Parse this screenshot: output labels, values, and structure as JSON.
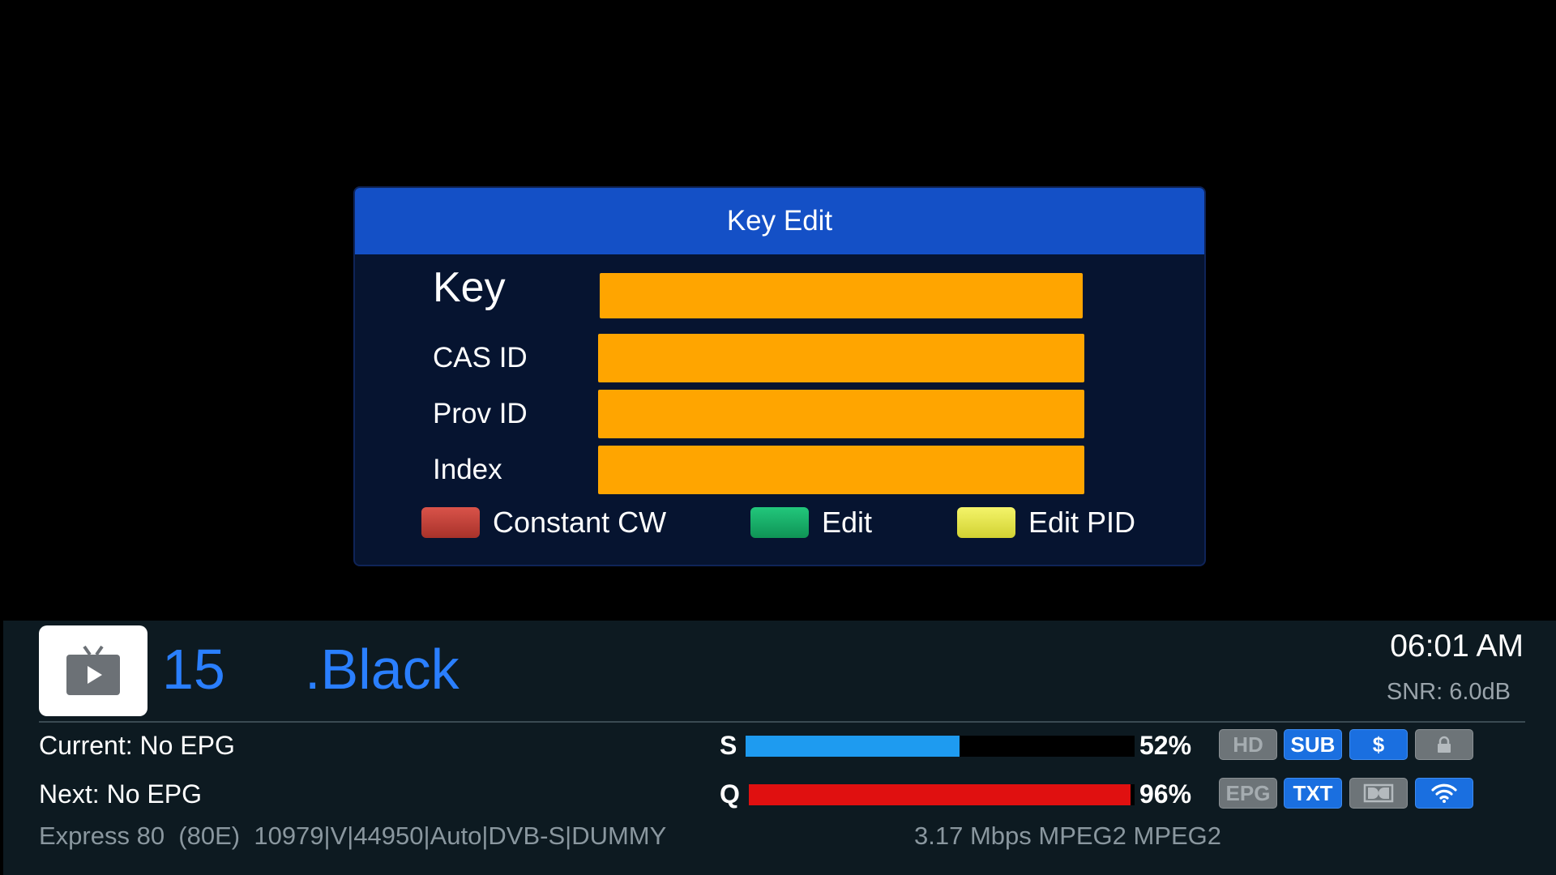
{
  "dialog": {
    "title": "Key Edit",
    "fields": [
      {
        "label": "Key",
        "value": ""
      },
      {
        "label": "CAS ID",
        "value": ""
      },
      {
        "label": "Prov ID",
        "value": ""
      },
      {
        "label": "Index",
        "value": ""
      }
    ],
    "legend": [
      {
        "label": "Constant CW",
        "color": "#c0392b"
      },
      {
        "label": "Edit",
        "color": "#16a765"
      },
      {
        "label": "Edit PID",
        "color": "#e8e84a"
      }
    ],
    "field_color": "#ffa500",
    "header_color": "#1450c6"
  },
  "infobar": {
    "channel_number": "15",
    "channel_name": ".Black",
    "time": "06:01 AM",
    "snr": "SNR: 6.0dB",
    "current_epg": "Current: No EPG",
    "next_epg": "Next: No EPG",
    "satellite": "Express 80  (80E)  10979|V|44950|Auto|DVB-S|DUMMY",
    "codec": "3.17 Mbps MPEG2 MPEG2",
    "signal": {
      "label": "S",
      "percent_text": "52%",
      "level": 0.55,
      "color": "#1e9bf0"
    },
    "quality": {
      "label": "Q",
      "percent_text": "96%",
      "level": 0.99,
      "color": "#e01010"
    },
    "badges_row1": [
      {
        "label": "HD",
        "state": "off"
      },
      {
        "label": "SUB",
        "state": "on"
      },
      {
        "label": "$",
        "state": "on"
      },
      {
        "label": "lock-icon",
        "state": "off"
      }
    ],
    "badges_row2": [
      {
        "label": "EPG",
        "state": "off"
      },
      {
        "label": "TXT",
        "state": "on"
      },
      {
        "label": "dolby-icon",
        "state": "off"
      },
      {
        "label": "wifi-icon",
        "state": "on"
      }
    ]
  }
}
